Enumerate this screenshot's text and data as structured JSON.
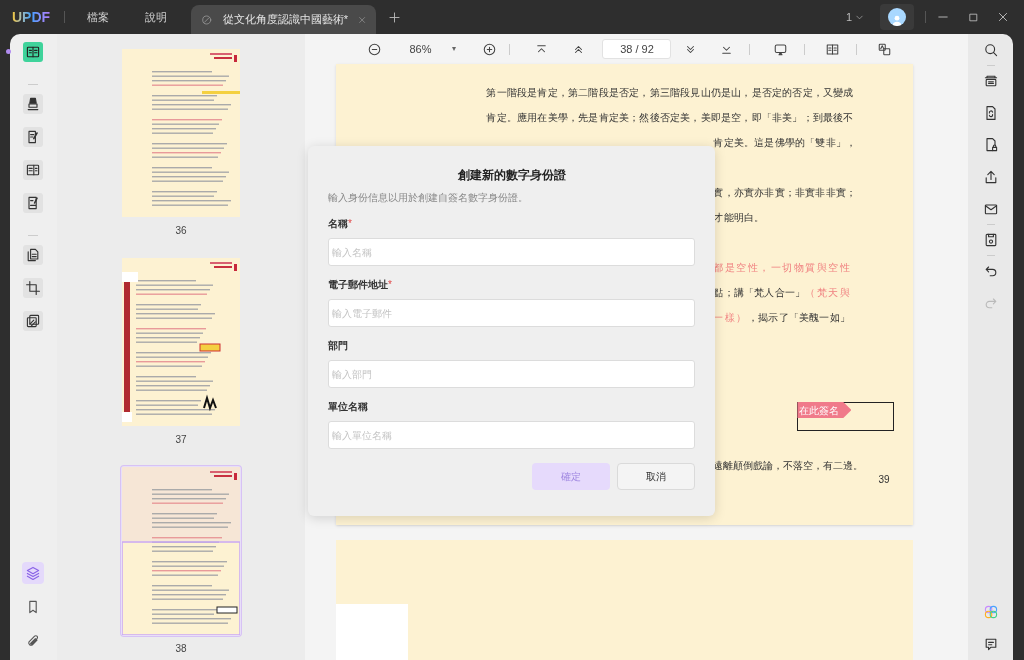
{
  "app": {
    "logo": "UPDF",
    "menu": [
      "檔案",
      "說明"
    ],
    "tab": {
      "title": "從文化角度認識中國藝術*",
      "selected": true
    },
    "page_count_badge": "1"
  },
  "left_toolbar": {
    "tools": [
      {
        "selected": true
      },
      {
        "selected": false
      },
      {
        "selected": false
      },
      {
        "selected": false
      },
      {
        "selected": false
      },
      {
        "selected": false
      },
      {
        "selected": false
      },
      {
        "selected": false
      }
    ],
    "bottom": [
      {
        "selected": true
      },
      {
        "selected": false
      },
      {
        "selected": false
      }
    ]
  },
  "thumbnails": [
    {
      "page": "36",
      "selected": false
    },
    {
      "page": "37",
      "selected": false
    },
    {
      "page": "38",
      "selected": true
    }
  ],
  "doc_toolbar": {
    "zoom": "86%",
    "dropdown": "▾",
    "page_field": "38 / 92"
  },
  "document": {
    "lines": [
      {
        "kind": "full",
        "segments": [
          {
            "text": "第一階段是肯定，第二階段是否定，第三階段見山仍是山，是否定的否定，又變成",
            "highlight": false
          }
        ]
      },
      {
        "kind": "full",
        "segments": [
          {
            "text": "肯定。應用在美學，先是肯定美；然後否定美，美即是空，即「非美」；到最後不",
            "highlight": false
          }
        ]
      },
      {
        "kind": "fragment",
        "segments": [
          {
            "text": "肯定美。這是佛學的「雙非」，",
            "highlight": false
          }
        ]
      },
      {
        "kind": "blank"
      },
      {
        "kind": "fragment",
        "segments": [
          {
            "text": "實，亦實亦非實；非實非非實；",
            "highlight": false
          }
        ]
      },
      {
        "kind": "fragment",
        "segments": [
          {
            "text": "才能明白。",
            "highlight": false
          }
        ]
      },
      {
        "kind": "blank"
      },
      {
        "kind": "fragment",
        "segments": [
          {
            "text": "都是空性，一切物質與空性",
            "highlight": true
          }
        ]
      },
      {
        "kind": "fragment",
        "segments": [
          {
            "text": "點；講「梵人合一」",
            "highlight": false
          },
          {
            "text": "（梵天與",
            "highlight": true
          }
        ]
      },
      {
        "kind": "fragment",
        "segments": [
          {
            "text": "一樣）",
            "highlight": true
          },
          {
            "text": "，揭示了「美醜一如」",
            "highlight": false
          }
        ]
      }
    ],
    "sign_tag": "在此簽名",
    "footnote": "遠離顛倒戲論，不落空，有二邊。",
    "page_number": "39"
  },
  "right_toolbar": {
    "tools": [
      {
        "disabled": false
      },
      {
        "disabled": false
      },
      {
        "disabled": false
      },
      {
        "disabled": false
      },
      {
        "disabled": false
      },
      {
        "disabled": false
      },
      {
        "disabled": false
      },
      {
        "disabled": false
      },
      {
        "disabled": true
      },
      {
        "disabled": false
      },
      {
        "disabled": false
      }
    ]
  },
  "dialog": {
    "title": "創建新的數字身份證",
    "subtitle": "輸入身份信息以用於創建自簽名數字身份證。",
    "fields": [
      {
        "label": "名稱",
        "required_mark": "*",
        "placeholder": "輸入名稱"
      },
      {
        "label": "電子郵件地址",
        "required_mark": "*",
        "placeholder": "輸入電子郵件"
      },
      {
        "label": "部門",
        "placeholder": "輸入部門"
      },
      {
        "label": "單位名稱",
        "placeholder": "輸入單位名稱"
      }
    ],
    "buttons": [
      {
        "label": "確定",
        "kind": "primary",
        "disabled": true
      },
      {
        "label": "取消",
        "kind": "secondary",
        "disabled": false
      }
    ]
  }
}
